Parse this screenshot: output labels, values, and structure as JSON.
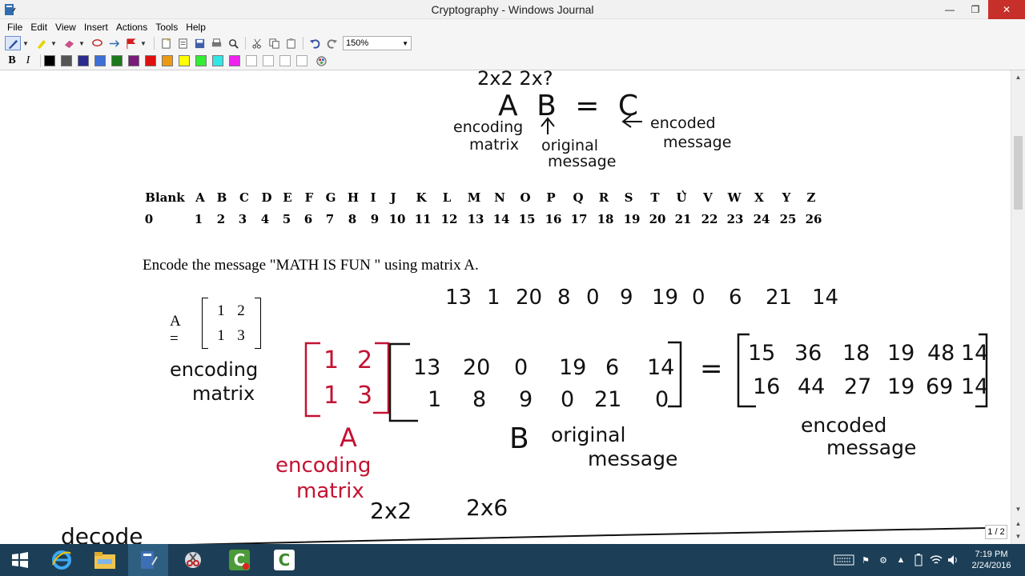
{
  "window": {
    "title": "Cryptography - Windows Journal"
  },
  "menu": [
    "File",
    "Edit",
    "View",
    "Insert",
    "Actions",
    "Tools",
    "Help"
  ],
  "toolbar": {
    "zoom": "150%"
  },
  "format": {
    "bold": "B",
    "italic": "I"
  },
  "colors": [
    "#000000",
    "#555555",
    "#2b2b8f",
    "#3d6fd8",
    "#1a7a1a",
    "#7b1a7b",
    "#e01010",
    "#ee9a10",
    "#ffff00",
    "#33ee33",
    "#33e6e6",
    "#ee22ee"
  ],
  "document": {
    "alphabet_letters": [
      "Blank",
      "A",
      "B",
      "C",
      "D",
      "E",
      "F",
      "G",
      "H",
      "I",
      "J",
      "K",
      "L",
      "M",
      "N",
      "O",
      "P",
      "Q",
      "R",
      "S",
      "T",
      "U",
      "V",
      "W",
      "X",
      "Y",
      "Z"
    ],
    "alphabet_numbers": [
      "0",
      "1",
      "2",
      "3",
      "4",
      "5",
      "6",
      "7",
      "8",
      "9",
      "10",
      "11",
      "12",
      "13",
      "14",
      "15",
      "16",
      "17",
      "18",
      "19",
      "20",
      "21",
      "22",
      "23",
      "24",
      "25",
      "26"
    ],
    "instruction": "Encode the message \"MATH IS FUN \" using matrix A.",
    "matrix_label": "A =",
    "matrix_cells": [
      "1",
      "2",
      "1",
      "3"
    ]
  },
  "ink": {
    "top_dims": "2x2 2x?",
    "equation": "A B = C",
    "enc_label_1": "encoding",
    "enc_label_2": "matrix",
    "orig_label_1": "original",
    "orig_label_2": "message",
    "encoded_label_1": "encoded",
    "encoded_label_2": "message",
    "sequence": [
      "13",
      "1",
      "20",
      "8",
      "0",
      "9",
      "19",
      "0",
      "6",
      "21",
      "14"
    ],
    "red_matrix": [
      "1",
      "2",
      "1",
      "3"
    ],
    "b_row1": [
      "13",
      "20",
      "0",
      "19",
      "6",
      "14"
    ],
    "b_row2": [
      "1",
      "8",
      "9",
      "0",
      "21",
      "0"
    ],
    "c_row1": [
      "15",
      "36",
      "18",
      "19",
      "48",
      "14"
    ],
    "c_row2": [
      "16",
      "44",
      "27",
      "19",
      "69",
      "14"
    ],
    "equals": "=",
    "a_enc_1": "encoding",
    "a_enc_2": "matrix",
    "b_letter": "B",
    "b_orig_1": "original",
    "b_orig_2": "message",
    "c_enc_1": "encoded",
    "c_enc_2": "message",
    "red_a": "A",
    "red_enc_1": "encoding",
    "red_enc_2": "matrix",
    "dim_a": "2x2",
    "dim_b": "2x6",
    "decode": "decode"
  },
  "page_indicator": "1 / 2",
  "clock": {
    "time": "7:19 PM",
    "date": "2/24/2016"
  }
}
